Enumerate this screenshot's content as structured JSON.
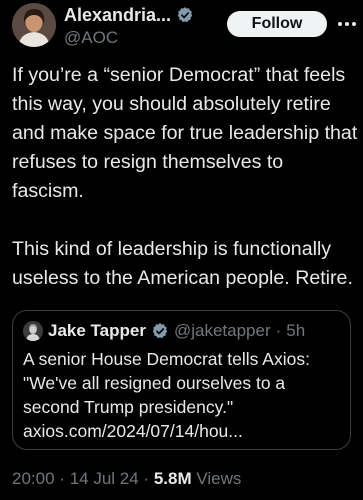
{
  "author": {
    "display_name": "Alexandria...",
    "handle": "@AOC",
    "follow_label": "Follow"
  },
  "tweet": {
    "paragraphs": [
      "If you’re a “senior Democrat” that feels this way, you should absolutely retire and make space for true leadership that refuses to resign themselves to fascism.",
      "This kind of leadership is functionally useless to the American people. Retire."
    ]
  },
  "quoted_tweet": {
    "display_name": "Jake Tapper",
    "handle": "@jaketapper",
    "separator": "·",
    "time": "5h",
    "text": "A senior House Democrat tells Axios: \"We've all resigned ourselves to a second Trump  presidency.\"",
    "link": "axios.com/2024/07/14/hou..."
  },
  "meta": {
    "time": "20:00",
    "dot1": "·",
    "date": "14 Jul 24",
    "dot2": "·",
    "views_count": "5.8M",
    "views_label": "Views"
  },
  "colors": {
    "background": "#000000",
    "text": "#e7e9ea",
    "muted": "#71767b",
    "verified_badge": "#829aab",
    "border": "#3a3f44"
  },
  "icons": [
    "verified-badge-icon",
    "more-options-icon"
  ]
}
